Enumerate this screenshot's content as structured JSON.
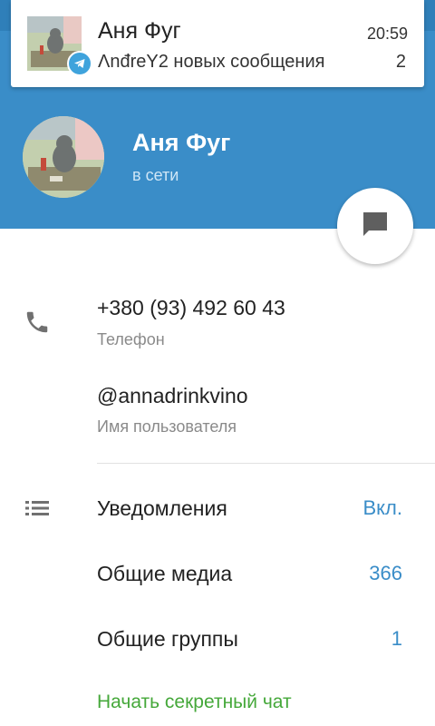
{
  "notification": {
    "title": "Аня Фуг",
    "time": "20:59",
    "text": "ΛnđreY2 новых сообщения",
    "count": "2",
    "badge_icon": "telegram-icon",
    "thumb_icon": "cat-photo-thumbnail"
  },
  "profile": {
    "name": "Аня Фуг",
    "status": "в сети",
    "avatar_icon": "cat-photo-avatar",
    "fab_icon": "chat-bubble-icon"
  },
  "info": {
    "phone": "+380 (93) 492 60 43",
    "phone_label": "Телефон",
    "username": "@annadrinkvino",
    "username_label": "Имя пользователя"
  },
  "settings": {
    "notifications_label": "Уведомления",
    "notifications_value": "Вкл.",
    "shared_media_label": "Общие медиа",
    "shared_media_value": "366",
    "shared_groups_label": "Общие группы",
    "shared_groups_value": "1",
    "secret_chat_label": "Начать секретный чат"
  },
  "colors": {
    "header": "#3a8dc8",
    "accent_blue": "#3a8dc8",
    "secret_green": "#45a83a"
  }
}
